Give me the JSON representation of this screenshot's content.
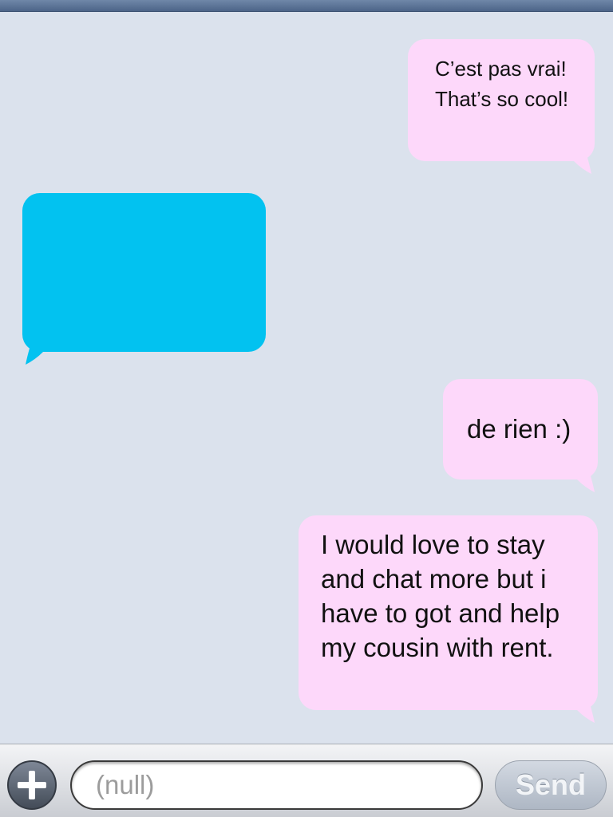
{
  "colors": {
    "background": "#dbe2ed",
    "sent_bubble": "#fdd8fa",
    "received_bubble": "#02c2f0",
    "toolbar": "#dfe1e5",
    "send_button": "#aeb7c4"
  },
  "messages": [
    {
      "direction": "sent",
      "text": "C’est pas vrai! That’s so cool!"
    },
    {
      "direction": "received",
      "text": ""
    },
    {
      "direction": "sent",
      "text": "de rien :)"
    },
    {
      "direction": "sent",
      "text": "I would love to stay and chat more but i have to got and help my cousin with rent."
    }
  ],
  "composer": {
    "add_icon": "plus-icon",
    "placeholder": "(null)",
    "value": "",
    "send_label": "Send"
  }
}
